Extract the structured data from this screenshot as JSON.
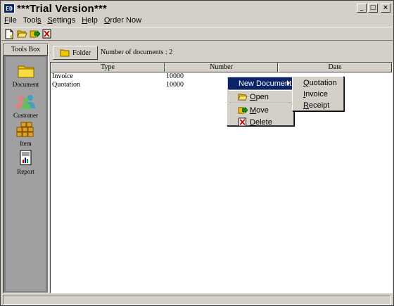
{
  "window": {
    "title": "***Trial Version***",
    "icon_label": "ED",
    "controls": {
      "minimize": "_",
      "maximize": "□",
      "close": "×"
    }
  },
  "menubar": {
    "items": [
      {
        "label": "File",
        "accel": "F",
        "rest": "ile"
      },
      {
        "label": "Tools",
        "accel": "s",
        "prefix": "Tool"
      },
      {
        "label": "Settings",
        "accel": "S",
        "rest": "ettings"
      },
      {
        "label": "Help",
        "accel": "H",
        "rest": "elp"
      },
      {
        "label": "Order Now",
        "accel": "O",
        "rest": "rder Now"
      }
    ]
  },
  "toolbar": {
    "icons": [
      "new-document-icon",
      "open-folder-icon",
      "move-icon",
      "delete-icon"
    ]
  },
  "toolsbox": {
    "title": "Tools Box",
    "items": [
      {
        "label": "Document",
        "icon": "folder-icon"
      },
      {
        "label": "Customer",
        "icon": "people-icon"
      },
      {
        "label": "Item",
        "icon": "boxes-icon"
      },
      {
        "label": "Report",
        "icon": "chart-report-icon"
      }
    ]
  },
  "main": {
    "folder_button": "Folder",
    "doc_count_text": "Number of documents :  2",
    "columns": [
      "Type",
      "Number",
      "Date"
    ],
    "rows": [
      {
        "type": "Invoice",
        "number": "10000",
        "date": ""
      },
      {
        "type": "Quotation",
        "number": "10000",
        "date": ""
      }
    ]
  },
  "context_menu": {
    "items": [
      {
        "label": "New Document",
        "highlighted": true,
        "has_submenu": true
      },
      {
        "label": "Open",
        "accel": "O",
        "rest": "pen",
        "icon": "open-folder-icon"
      },
      {
        "label": "Move",
        "accel": "M",
        "rest": "ove",
        "icon": "move-icon"
      },
      {
        "label": "Delete",
        "accel": "D",
        "rest": "elete",
        "icon": "delete-icon"
      }
    ],
    "submenu": [
      {
        "label": "Quotation",
        "accel": "Q",
        "rest": "uotation"
      },
      {
        "label": "Invoice",
        "accel": "I",
        "rest": "nvoice"
      },
      {
        "label": "Receipt",
        "accel": "R",
        "rest": "eceipt"
      }
    ]
  },
  "colors": {
    "face": "#d4d0c8",
    "highlight": "#0a246a",
    "sidebar": "#a0a0a0"
  }
}
